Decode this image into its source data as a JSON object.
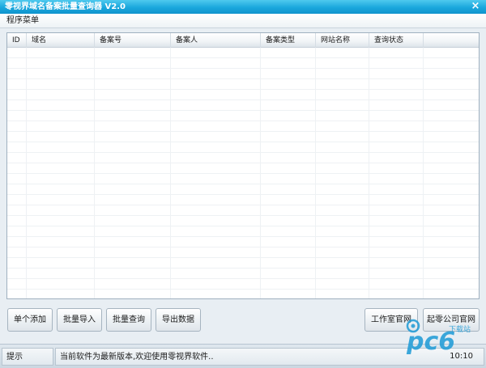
{
  "window": {
    "title": "零视界域名备案批量查询器 V2.0",
    "close_symbol": "×"
  },
  "menu": {
    "items": [
      {
        "label": "程序菜单"
      }
    ]
  },
  "table": {
    "columns": [
      {
        "label": "ID"
      },
      {
        "label": "域名"
      },
      {
        "label": "备案号"
      },
      {
        "label": "备案人"
      },
      {
        "label": "备案类型"
      },
      {
        "label": "网站名称"
      },
      {
        "label": "查询状态"
      }
    ],
    "rows": []
  },
  "buttons": {
    "add_single": "单个添加",
    "batch_import": "批量导入",
    "batch_query": "批量查询",
    "export_data": "导出数据",
    "studio_site": "工作室官网",
    "company_site": "起零公司官网"
  },
  "status": {
    "label": "提示",
    "message": "当前软件为最新版本,欢迎使用零视界软件..",
    "time": "10:10"
  },
  "watermark": {
    "text": "pc6",
    "subtext": "下载站",
    "color": "#1c9ad6"
  }
}
